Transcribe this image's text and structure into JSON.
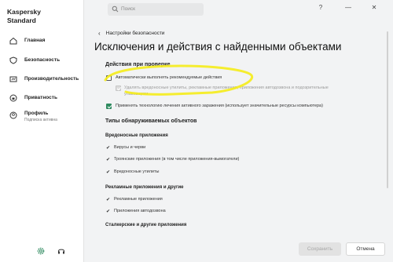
{
  "app": {
    "brand_line1": "Kaspersky",
    "brand_line2": "Standard"
  },
  "sidebar": {
    "items": [
      {
        "label": "Главная",
        "icon": "home-icon"
      },
      {
        "label": "Безопасность",
        "icon": "shield-icon"
      },
      {
        "label": "Производительность",
        "icon": "performance-icon"
      },
      {
        "label": "Приватность",
        "icon": "lock-icon"
      },
      {
        "label": "Профиль",
        "sub": "Подписка активна",
        "icon": "profile-icon"
      }
    ],
    "bottom": {
      "settings_icon": "gear-icon",
      "support_icon": "headset-icon"
    }
  },
  "topbar": {
    "search_placeholder": "Поиск",
    "help": "?",
    "minimize": "—",
    "close": "✕"
  },
  "breadcrumb": {
    "back": "Настройки безопасности"
  },
  "page": {
    "title": "Исключения и действия с найденными объектами"
  },
  "sections": {
    "actions_title": "Действия при проверке",
    "opt_auto": "Автоматически выполнять рекомендуемые действия",
    "opt_delete_1": "Удалять вредоносные утилиты, рекламные приложения, приложения автодозвона и подозрительные",
    "opt_delete_2": "упаковщики",
    "opt_active": "Применять технологию лечения активного заражения (использует значительные ресурсы компьютера)",
    "detect_title": "Типы обнаруживаемых объектов",
    "malware_title": "Вредоносные приложения",
    "malware_items": [
      "Вирусы и черви",
      "Троянские приложения (в том числе приложения-вымогатели)",
      "Вредоносные утилиты"
    ],
    "adware_title": "Рекламные приложения и другие",
    "adware_items": [
      "Рекламные приложения",
      "Приложения автодозвона"
    ],
    "stalker_title": "Сталкерские и другие приложения"
  },
  "footer": {
    "save": "Сохранить",
    "cancel": "Отмена"
  },
  "colors": {
    "accent": "#2e8a5f",
    "highlight": "#f5ec1a"
  }
}
